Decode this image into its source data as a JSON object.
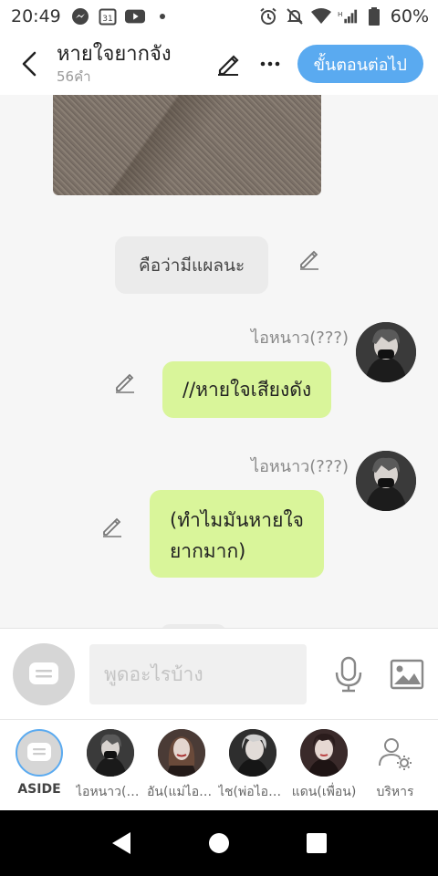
{
  "status_bar": {
    "time": "20:49",
    "battery": "60%",
    "left_icons": [
      "messenger-icon",
      "calendar-icon",
      "youtube-icon",
      "dot-icon"
    ],
    "right_icons": [
      "alarm-icon",
      "mute-icon",
      "wifi-icon",
      "signal-icon",
      "battery-icon"
    ]
  },
  "header": {
    "title": "หายใจยากจัง",
    "word_count": "56คำ",
    "next_label": "ขั้นตอนต่อไป",
    "accent": "#5aaaf0"
  },
  "messages": {
    "narration": "คือว่ามีแผลนะ",
    "msg1": {
      "speaker": "ไอหนาว(???)",
      "text": "//หายใจเสียงดัง"
    },
    "msg2": {
      "speaker": "ไอหนาว(???)",
      "line1": "(ทำไมมันหายใจ",
      "line2": "ยากมาก)"
    },
    "bubble_color": "#d9f59a"
  },
  "input": {
    "placeholder": "พูดอะไรบ้าง"
  },
  "characters": [
    {
      "name": "ASIDE"
    },
    {
      "name": "ไอหนาว(???)"
    },
    {
      "name": "อัน(แม่ไอหนาว)"
    },
    {
      "name": "ไช(พ่อไอหนาว)"
    },
    {
      "name": "แดน(เพื่อน)"
    },
    {
      "name": "บริหาร"
    }
  ]
}
